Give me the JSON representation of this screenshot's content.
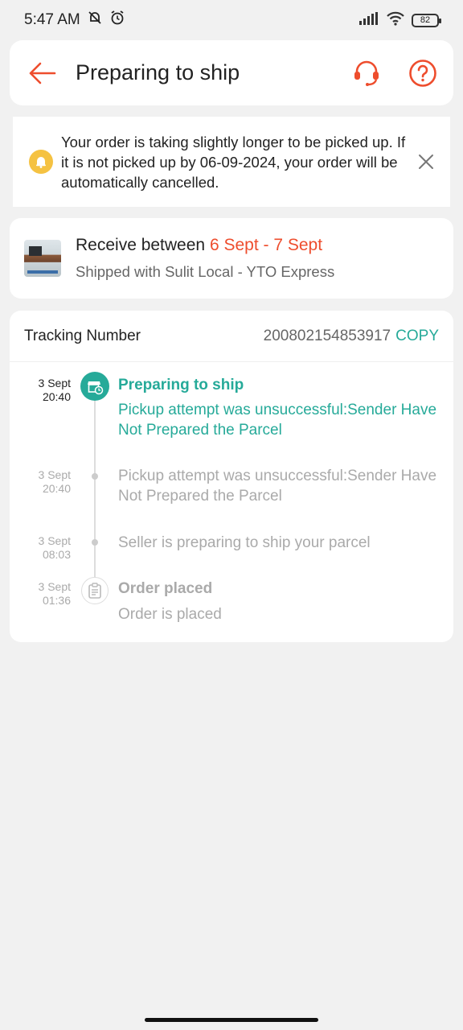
{
  "status_bar": {
    "time": "5:47 AM",
    "battery": "82"
  },
  "header": {
    "title": "Preparing to ship"
  },
  "notice": {
    "text": "Your order is taking slightly longer to be picked up. If it is not picked up by 06-09-2024, your order will be automatically cancelled."
  },
  "delivery": {
    "receive_prefix": "Receive between",
    "receive_dates": "6 Sept - 7 Sept",
    "shipped_with": "Shipped with Sulit Local - YTO Express"
  },
  "tracking": {
    "label": "Tracking Number",
    "number": "200802154853917",
    "copy_label": "COPY",
    "events": [
      {
        "date": "3 Sept",
        "time": "20:40",
        "title": "Preparing to ship",
        "detail": "Pickup attempt was unsuccessful:Sender Have Not Prepared the Parcel"
      },
      {
        "date": "3 Sept",
        "time": "20:40",
        "detail": "Pickup attempt was unsuccessful:Sender Have Not Prepared the Parcel"
      },
      {
        "date": "3 Sept",
        "time": "08:03",
        "detail": "Seller is preparing to ship your parcel"
      },
      {
        "date": "3 Sept",
        "time": "01:36",
        "title": "Order placed",
        "detail": "Order is placed"
      }
    ]
  },
  "colors": {
    "brand": "#ee4d2d",
    "teal": "#26aa99",
    "bell": "#f5c242"
  }
}
